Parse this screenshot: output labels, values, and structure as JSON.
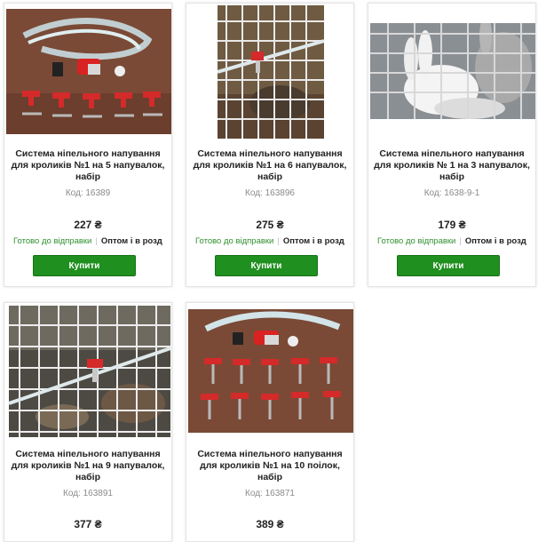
{
  "products": [
    {
      "title": "Система нiпельного напування для кроликів №1 на 5 напувалок, набір",
      "code": "Код: 16389",
      "price": "227 ₴",
      "status": "Готово до відправки",
      "wholesale": "Оптом і в розд",
      "buy_label": "Купити"
    },
    {
      "title": "Система нiпельного напування для кроликів №1 на 6 напувалок, набір",
      "code": "Код: 163896",
      "price": "275 ₴",
      "status": "Готово до відправки",
      "wholesale": "Оптом і в розд",
      "buy_label": "Купити"
    },
    {
      "title": "Система нiпельного напування для кроликів № 1 на 3 напувалок, набір",
      "code": "Код: 1638-9-1",
      "price": "179 ₴",
      "status": "Готово до відправки",
      "wholesale": "Оптом і в розд",
      "buy_label": "Купити"
    },
    {
      "title": "Система нiпельного напування для кроликів №1 на 9 напувалок, набір",
      "code": "Код: 163891",
      "price": "377 ₴"
    },
    {
      "title": "Система нiпельного напування для кроликів №1 на 10 поілок, набір",
      "code": "Код: 163871",
      "price": "389 ₴"
    }
  ],
  "colors": {
    "buy_button": "#1f8f1f",
    "ready_text": "#2f8f2f"
  },
  "images": [
    "nipple-kit-hose-photo",
    "rabbit-cage-drinker-photo",
    "white-rabbits-cage-photo",
    "rabbit-cage-drinker-photo",
    "nipple-kit-10-photo"
  ]
}
